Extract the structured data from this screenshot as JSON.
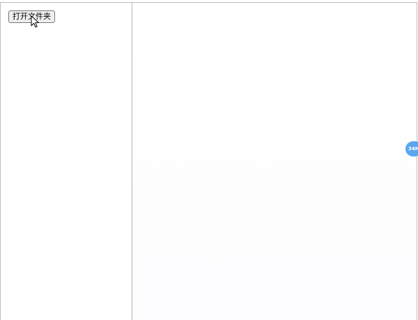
{
  "sidebar": {
    "open_folder_label": "打开文件夹"
  },
  "floating_badge": {
    "text": "34M",
    "color": "#5aa6f0"
  },
  "colors": {
    "border": "#bdbdbd",
    "divider": "#b4b4b4",
    "button_bg": "#efefef"
  },
  "icons": {
    "cursor": "mouse-pointer-icon"
  }
}
